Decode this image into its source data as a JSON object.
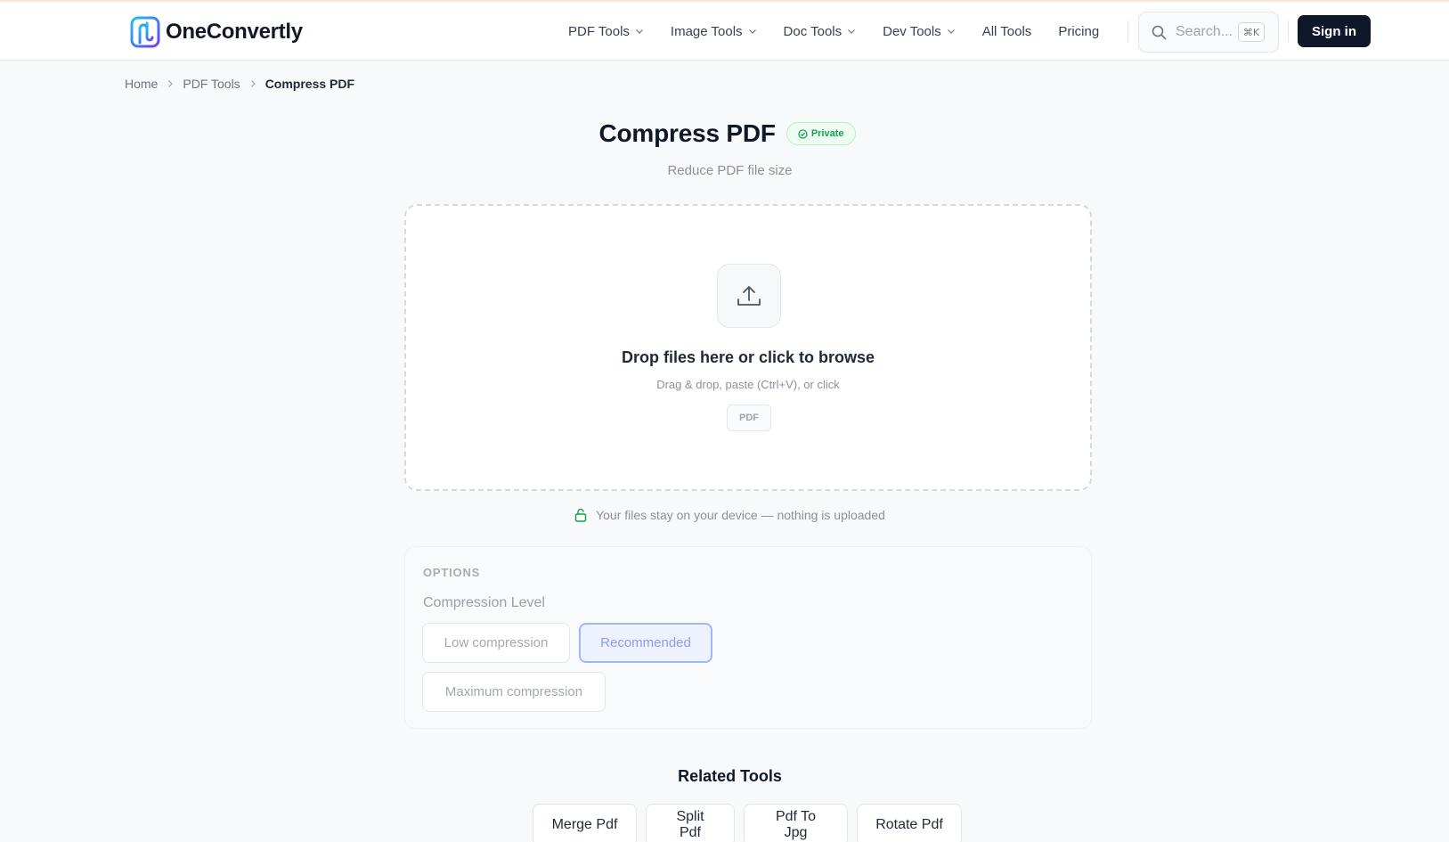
{
  "header": {
    "brand": "OneConvertly",
    "nav": [
      {
        "label": "PDF Tools",
        "dropdown": true
      },
      {
        "label": "Image Tools",
        "dropdown": true
      },
      {
        "label": "Doc Tools",
        "dropdown": true
      },
      {
        "label": "Dev Tools",
        "dropdown": true
      },
      {
        "label": "All Tools",
        "dropdown": false
      },
      {
        "label": "Pricing",
        "dropdown": false
      }
    ],
    "search_placeholder": "Search...",
    "search_shortcut": "⌘K",
    "signin_label": "Sign in"
  },
  "breadcrumb": {
    "items": [
      "Home",
      "PDF Tools"
    ],
    "current": "Compress PDF"
  },
  "page": {
    "title": "Compress PDF",
    "badge": "Private",
    "subtitle": "Reduce PDF file size"
  },
  "dropzone": {
    "title": "Drop files here or click to browse",
    "subtitle": "Drag & drop, paste (Ctrl+V), or click",
    "format": "PDF",
    "icon": "upload-icon"
  },
  "privacy_note": "Your files stay on your device — nothing is uploaded",
  "options": {
    "heading": "OPTIONS",
    "label": "Compression Level",
    "choices": [
      "Low compression",
      "Recommended",
      "Maximum compression"
    ],
    "selected": "Recommended"
  },
  "related": {
    "title": "Related Tools",
    "tools": [
      "Merge Pdf",
      "Split Pdf",
      "Pdf To Jpg",
      "Rotate Pdf"
    ]
  },
  "colors": {
    "accent_dark": "#0f172a",
    "private_green": "#16a34a",
    "selected_indigo": "#a5b4fc"
  }
}
